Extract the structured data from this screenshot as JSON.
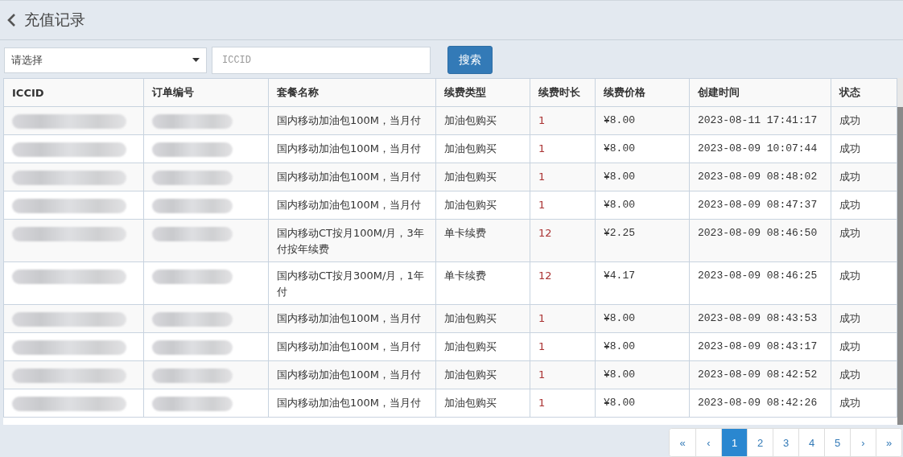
{
  "header": {
    "title": "充值记录"
  },
  "filters": {
    "select": {
      "placeholder": "请选择"
    },
    "iccid": {
      "placeholder": "ICCID"
    },
    "search_button": "搜索"
  },
  "table": {
    "columns": [
      "ICCID",
      "订单编号",
      "套餐名称",
      "续费类型",
      "续费时长",
      "续费价格",
      "创建时间",
      "状态"
    ],
    "rows": [
      {
        "redacted": true,
        "package": "国内移动加油包100M，当月付",
        "type": "加油包购买",
        "duration": "1",
        "price": "¥8.00",
        "created": "2023-08-11 17:41:17",
        "status": "成功"
      },
      {
        "redacted": true,
        "package": "国内移动加油包100M，当月付",
        "type": "加油包购买",
        "duration": "1",
        "price": "¥8.00",
        "created": "2023-08-09 10:07:44",
        "status": "成功"
      },
      {
        "redacted": true,
        "package": "国内移动加油包100M，当月付",
        "type": "加油包购买",
        "duration": "1",
        "price": "¥8.00",
        "created": "2023-08-09 08:48:02",
        "status": "成功"
      },
      {
        "redacted": true,
        "package": "国内移动加油包100M，当月付",
        "type": "加油包购买",
        "duration": "1",
        "price": "¥8.00",
        "created": "2023-08-09 08:47:37",
        "status": "成功"
      },
      {
        "redacted": true,
        "package": "国内移动CT按月100M/月，3年付按年续费",
        "type": "单卡续费",
        "duration": "12",
        "price": "¥2.25",
        "created": "2023-08-09 08:46:50",
        "status": "成功"
      },
      {
        "redacted": true,
        "package": "国内移动CT按月300M/月，1年付",
        "type": "单卡续费",
        "duration": "12",
        "price": "¥4.17",
        "created": "2023-08-09 08:46:25",
        "status": "成功"
      },
      {
        "redacted": true,
        "package": "国内移动加油包100M，当月付",
        "type": "加油包购买",
        "duration": "1",
        "price": "¥8.00",
        "created": "2023-08-09 08:43:53",
        "status": "成功"
      },
      {
        "redacted": true,
        "package": "国内移动加油包100M，当月付",
        "type": "加油包购买",
        "duration": "1",
        "price": "¥8.00",
        "created": "2023-08-09 08:43:17",
        "status": "成功"
      },
      {
        "redacted": true,
        "package": "国内移动加油包100M，当月付",
        "type": "加油包购买",
        "duration": "1",
        "price": "¥8.00",
        "created": "2023-08-09 08:42:52",
        "status": "成功"
      },
      {
        "redacted": true,
        "package": "国内移动加油包100M，当月付",
        "type": "加油包购买",
        "duration": "1",
        "price": "¥8.00",
        "created": "2023-08-09 08:42:26",
        "status": "成功"
      }
    ]
  },
  "pagination": [
    {
      "label": "«",
      "selected": false
    },
    {
      "label": "‹",
      "selected": false
    },
    {
      "label": "1",
      "selected": true
    },
    {
      "label": "2",
      "selected": false
    },
    {
      "label": "3",
      "selected": false
    },
    {
      "label": "4",
      "selected": false
    },
    {
      "label": "5",
      "selected": false
    },
    {
      "label": "›",
      "selected": false
    },
    {
      "label": "»",
      "selected": false
    }
  ]
}
